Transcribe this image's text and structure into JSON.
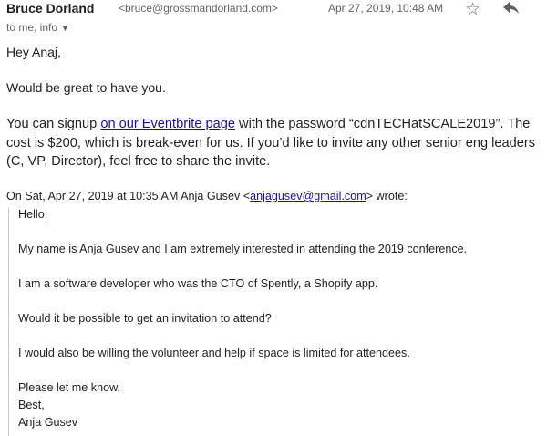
{
  "header": {
    "sender_name": "Bruce Dorland",
    "sender_email": "<bruce@grossmandorland.com>",
    "date": "Apr 27, 2019, 10:48 AM",
    "recipients": "to me, info",
    "star_icon": "star-outline",
    "reply_icon": "reply-arrow"
  },
  "body": {
    "greeting": "Hey Anaj,",
    "line1": "Would be great to have you.",
    "para_before_link": "You can signup ",
    "link_text": "on our Eventbrite page",
    "para_after_link": " with the password “cdnTECHatSCALE2019”. The cost is $200, which is break-even for us. If you’d like to invite any other senior eng leaders (C, VP, Director), feel free to share the invite."
  },
  "quoted": {
    "header_prefix": "On Sat, Apr 27, 2019 at 10:35 AM Anja Gusev <",
    "header_email": "anjagusev@gmail.com",
    "header_suffix": "> wrote:",
    "lines": [
      "Hello,",
      "My name is Anja Gusev and I am extremely interested in attending the 2019 conference.",
      "I am a software developer who was the CTO of Spently, a Shopify app.",
      "Would it be possible to get an invitation to attend?",
      "I would also be willing the volunteer and help if space is limited for attendees.",
      "Please let me know.",
      "Best,",
      "Anja Gusev"
    ]
  }
}
